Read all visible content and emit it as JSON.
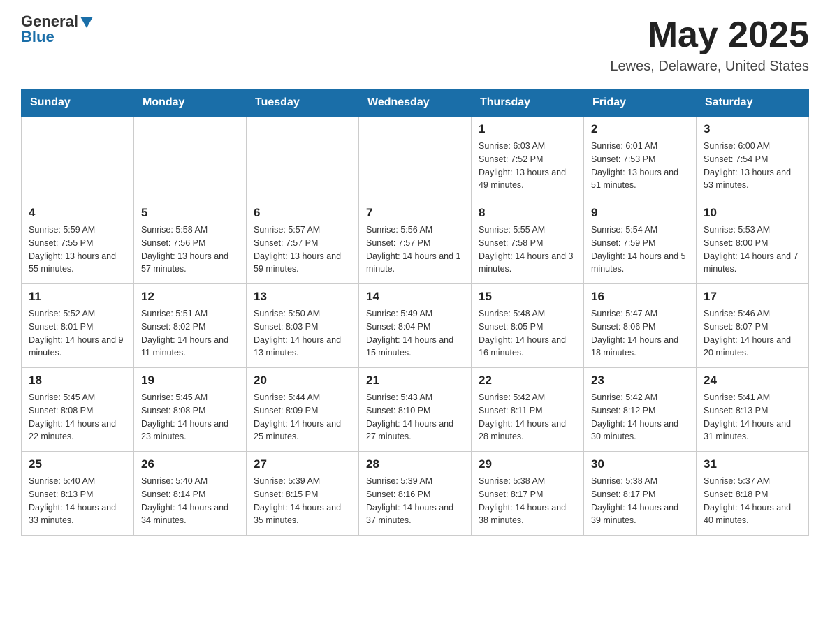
{
  "header": {
    "logo_general": "General",
    "logo_blue": "Blue",
    "title": "May 2025",
    "subtitle": "Lewes, Delaware, United States"
  },
  "days_of_week": [
    "Sunday",
    "Monday",
    "Tuesday",
    "Wednesday",
    "Thursday",
    "Friday",
    "Saturday"
  ],
  "weeks": [
    [
      {
        "day": "",
        "info": ""
      },
      {
        "day": "",
        "info": ""
      },
      {
        "day": "",
        "info": ""
      },
      {
        "day": "",
        "info": ""
      },
      {
        "day": "1",
        "info": "Sunrise: 6:03 AM\nSunset: 7:52 PM\nDaylight: 13 hours and 49 minutes."
      },
      {
        "day": "2",
        "info": "Sunrise: 6:01 AM\nSunset: 7:53 PM\nDaylight: 13 hours and 51 minutes."
      },
      {
        "day": "3",
        "info": "Sunrise: 6:00 AM\nSunset: 7:54 PM\nDaylight: 13 hours and 53 minutes."
      }
    ],
    [
      {
        "day": "4",
        "info": "Sunrise: 5:59 AM\nSunset: 7:55 PM\nDaylight: 13 hours and 55 minutes."
      },
      {
        "day": "5",
        "info": "Sunrise: 5:58 AM\nSunset: 7:56 PM\nDaylight: 13 hours and 57 minutes."
      },
      {
        "day": "6",
        "info": "Sunrise: 5:57 AM\nSunset: 7:57 PM\nDaylight: 13 hours and 59 minutes."
      },
      {
        "day": "7",
        "info": "Sunrise: 5:56 AM\nSunset: 7:57 PM\nDaylight: 14 hours and 1 minute."
      },
      {
        "day": "8",
        "info": "Sunrise: 5:55 AM\nSunset: 7:58 PM\nDaylight: 14 hours and 3 minutes."
      },
      {
        "day": "9",
        "info": "Sunrise: 5:54 AM\nSunset: 7:59 PM\nDaylight: 14 hours and 5 minutes."
      },
      {
        "day": "10",
        "info": "Sunrise: 5:53 AM\nSunset: 8:00 PM\nDaylight: 14 hours and 7 minutes."
      }
    ],
    [
      {
        "day": "11",
        "info": "Sunrise: 5:52 AM\nSunset: 8:01 PM\nDaylight: 14 hours and 9 minutes."
      },
      {
        "day": "12",
        "info": "Sunrise: 5:51 AM\nSunset: 8:02 PM\nDaylight: 14 hours and 11 minutes."
      },
      {
        "day": "13",
        "info": "Sunrise: 5:50 AM\nSunset: 8:03 PM\nDaylight: 14 hours and 13 minutes."
      },
      {
        "day": "14",
        "info": "Sunrise: 5:49 AM\nSunset: 8:04 PM\nDaylight: 14 hours and 15 minutes."
      },
      {
        "day": "15",
        "info": "Sunrise: 5:48 AM\nSunset: 8:05 PM\nDaylight: 14 hours and 16 minutes."
      },
      {
        "day": "16",
        "info": "Sunrise: 5:47 AM\nSunset: 8:06 PM\nDaylight: 14 hours and 18 minutes."
      },
      {
        "day": "17",
        "info": "Sunrise: 5:46 AM\nSunset: 8:07 PM\nDaylight: 14 hours and 20 minutes."
      }
    ],
    [
      {
        "day": "18",
        "info": "Sunrise: 5:45 AM\nSunset: 8:08 PM\nDaylight: 14 hours and 22 minutes."
      },
      {
        "day": "19",
        "info": "Sunrise: 5:45 AM\nSunset: 8:08 PM\nDaylight: 14 hours and 23 minutes."
      },
      {
        "day": "20",
        "info": "Sunrise: 5:44 AM\nSunset: 8:09 PM\nDaylight: 14 hours and 25 minutes."
      },
      {
        "day": "21",
        "info": "Sunrise: 5:43 AM\nSunset: 8:10 PM\nDaylight: 14 hours and 27 minutes."
      },
      {
        "day": "22",
        "info": "Sunrise: 5:42 AM\nSunset: 8:11 PM\nDaylight: 14 hours and 28 minutes."
      },
      {
        "day": "23",
        "info": "Sunrise: 5:42 AM\nSunset: 8:12 PM\nDaylight: 14 hours and 30 minutes."
      },
      {
        "day": "24",
        "info": "Sunrise: 5:41 AM\nSunset: 8:13 PM\nDaylight: 14 hours and 31 minutes."
      }
    ],
    [
      {
        "day": "25",
        "info": "Sunrise: 5:40 AM\nSunset: 8:13 PM\nDaylight: 14 hours and 33 minutes."
      },
      {
        "day": "26",
        "info": "Sunrise: 5:40 AM\nSunset: 8:14 PM\nDaylight: 14 hours and 34 minutes."
      },
      {
        "day": "27",
        "info": "Sunrise: 5:39 AM\nSunset: 8:15 PM\nDaylight: 14 hours and 35 minutes."
      },
      {
        "day": "28",
        "info": "Sunrise: 5:39 AM\nSunset: 8:16 PM\nDaylight: 14 hours and 37 minutes."
      },
      {
        "day": "29",
        "info": "Sunrise: 5:38 AM\nSunset: 8:17 PM\nDaylight: 14 hours and 38 minutes."
      },
      {
        "day": "30",
        "info": "Sunrise: 5:38 AM\nSunset: 8:17 PM\nDaylight: 14 hours and 39 minutes."
      },
      {
        "day": "31",
        "info": "Sunrise: 5:37 AM\nSunset: 8:18 PM\nDaylight: 14 hours and 40 minutes."
      }
    ]
  ]
}
